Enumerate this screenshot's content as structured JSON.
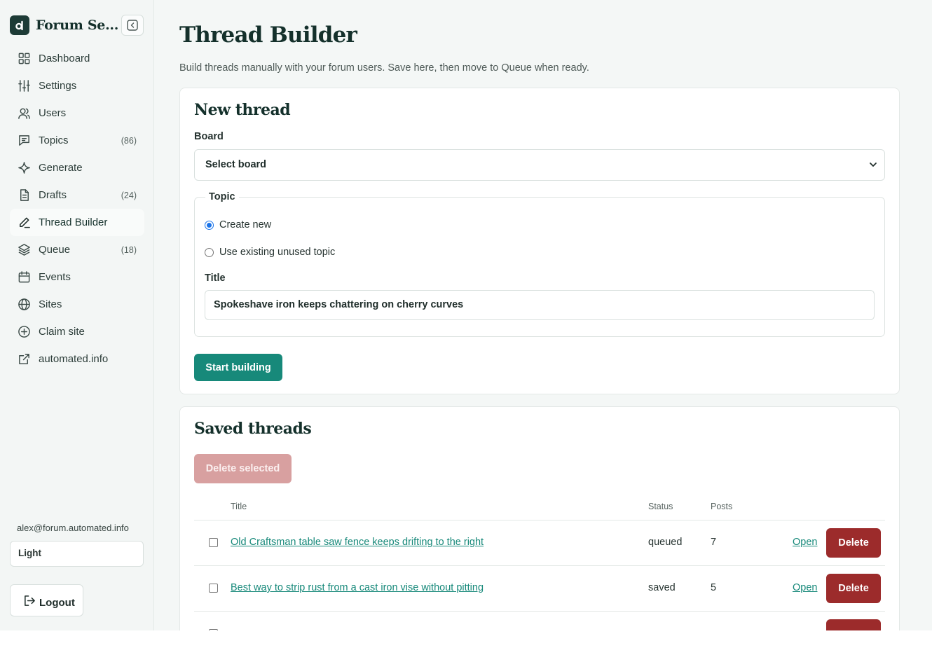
{
  "brand": {
    "name": "Forum Se..."
  },
  "sidebar": {
    "items": [
      {
        "label": "Dashboard",
        "icon": "grid-icon",
        "count": ""
      },
      {
        "label": "Settings",
        "icon": "sliders-icon",
        "count": ""
      },
      {
        "label": "Users",
        "icon": "users-icon",
        "count": ""
      },
      {
        "label": "Topics",
        "icon": "message-square-icon",
        "count": "(86)"
      },
      {
        "label": "Generate",
        "icon": "sparkle-icon",
        "count": ""
      },
      {
        "label": "Drafts",
        "icon": "file-icon",
        "count": "(24)"
      },
      {
        "label": "Thread Builder",
        "icon": "pen-icon",
        "count": "",
        "active": true
      },
      {
        "label": "Queue",
        "icon": "layers-icon",
        "count": "(18)"
      },
      {
        "label": "Events",
        "icon": "calendar-icon",
        "count": ""
      },
      {
        "label": "Sites",
        "icon": "globe-icon",
        "count": ""
      },
      {
        "label": "Claim site",
        "icon": "plus-circle-icon",
        "count": ""
      },
      {
        "label": "automated.info",
        "icon": "external-link-icon",
        "count": ""
      }
    ],
    "user_email": "alex@forum.automated.info",
    "theme_value": "Light",
    "logout_label": "Logout"
  },
  "page": {
    "title": "Thread Builder",
    "subtitle": "Build threads manually with your forum users. Save here, then move to Queue when ready."
  },
  "new_thread": {
    "title": "New thread",
    "board_label": "Board",
    "board_value": "Select board",
    "topic_legend": "Topic",
    "options": [
      "Create new",
      "Use existing unused topic"
    ],
    "selected_option": "Create new",
    "title_label": "Title",
    "title_value": "Spokeshave iron keeps chattering on cherry curves",
    "submit_label": "Start building"
  },
  "saved_threads": {
    "title": "Saved threads",
    "delete_selected_label": "Delete selected",
    "columns": [
      "Title",
      "Status",
      "Posts"
    ],
    "rows": [
      {
        "title": "Old Craftsman table saw fence keeps drifting to the right",
        "status": "queued",
        "posts": "7",
        "open": "Open",
        "delete": "Delete"
      },
      {
        "title": "Best way to strip rust from a cast iron vise without pitting",
        "status": "saved",
        "posts": "5",
        "open": "Open",
        "delete": "Delete"
      }
    ]
  },
  "colors": {
    "accent": "#17897a",
    "danger": "#9c2b2b",
    "danger_disabled": "#d8a0a0",
    "heading": "#14302b",
    "sidebar_bg": "#f3f6f5",
    "main_bg": "#f4f7f6"
  }
}
